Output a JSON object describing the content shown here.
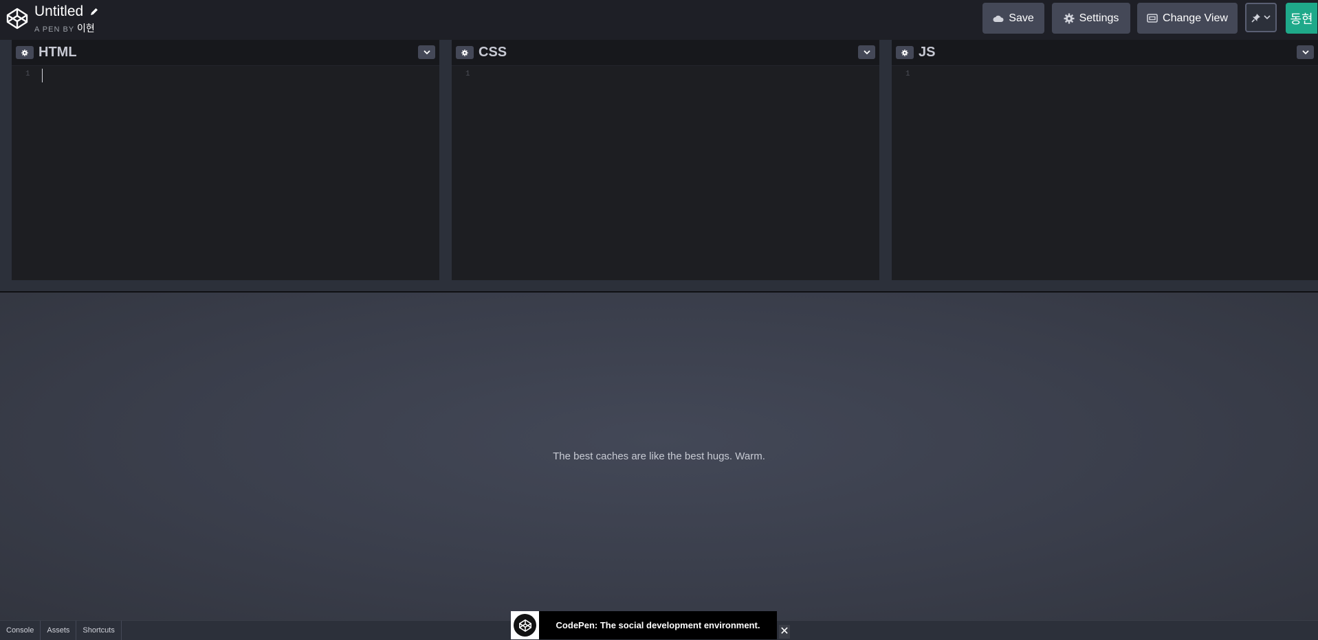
{
  "header": {
    "title": "Untitled",
    "byline_prefix": "A PEN BY",
    "author": "이현",
    "buttons": {
      "save": "Save",
      "settings": "Settings",
      "change_view": "Change View"
    },
    "avatar_text": "동현",
    "colors": {
      "avatar": "#1fa98a",
      "button": "#444857"
    }
  },
  "editors": [
    {
      "label": "HTML",
      "line": "1"
    },
    {
      "label": "CSS",
      "line": "1"
    },
    {
      "label": "JS",
      "line": "1"
    }
  ],
  "preview": {
    "message": "The best caches are like the best hugs. Warm."
  },
  "footer": {
    "tabs": [
      "Console",
      "Assets",
      "Shortcuts"
    ]
  },
  "toast": {
    "text": "CodePen: The social development environment.",
    "close": "✕"
  }
}
